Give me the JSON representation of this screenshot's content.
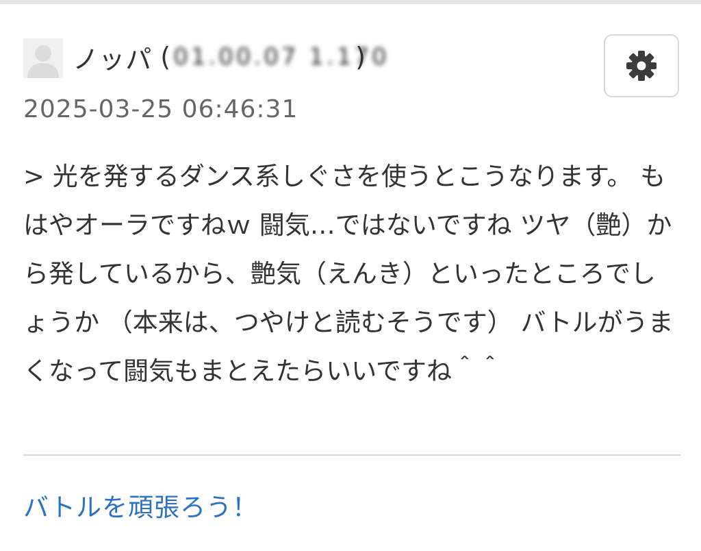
{
  "comment": {
    "author_name": "ノッパ",
    "ip_open": "(",
    "ip_masked_text": "01.00.07 1.170",
    "ip_close": ")",
    "timestamp": "2025-03-25 06:46:31",
    "body": "> 光を発するダンス系しぐさを使うとこうなります。 もはやオーラですねｗ 闘気…ではないですね ツヤ（艶）から発しているから、艶気（えんき）といったところでしょうか （本来は、つやけと読むそうです） バトルがうまくなって闘気もまとえたらいいですね＾＾"
  },
  "entry_link": {
    "label": "バトルを頑張ろう！"
  },
  "icons": {
    "avatar": "default-user-icon",
    "settings": "gear-icon"
  },
  "colors": {
    "link": "#2a72c4",
    "text": "#333333",
    "timestamp": "#666666",
    "gear": "#3c3c3c"
  }
}
